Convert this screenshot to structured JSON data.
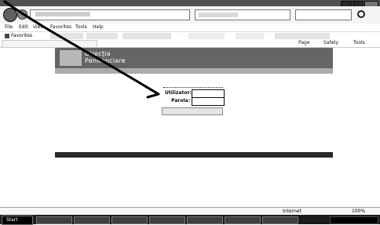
{
  "window": {
    "title": "",
    "address": "",
    "search_placeholder": ""
  },
  "menubar": {
    "items": [
      "File",
      "Edit",
      "View",
      "Favorites",
      "Tools",
      "Help"
    ]
  },
  "favorites_bar": {
    "favorites_label": "Favorites"
  },
  "command_bar": {
    "items": [
      "Page",
      "Safety",
      "Tools"
    ]
  },
  "page": {
    "header": {
      "title_line1": "Direcţia",
      "title_line2": "Penitenciare",
      "right_line1": "",
      "right_line2": ""
    },
    "login": {
      "username_label": "Utilizator:",
      "password_label": "Parola:",
      "username_value": "",
      "password_value": ""
    },
    "notices": [
      "",
      ""
    ],
    "footer": {
      "text": ""
    }
  },
  "status_bar": {
    "zone": "Internet",
    "zoom": "100%"
  },
  "taskbar": {
    "start_label": "Start"
  },
  "annotations": {
    "colors": {
      "ink": "#111111"
    },
    "arrow": "hand-drawn"
  }
}
